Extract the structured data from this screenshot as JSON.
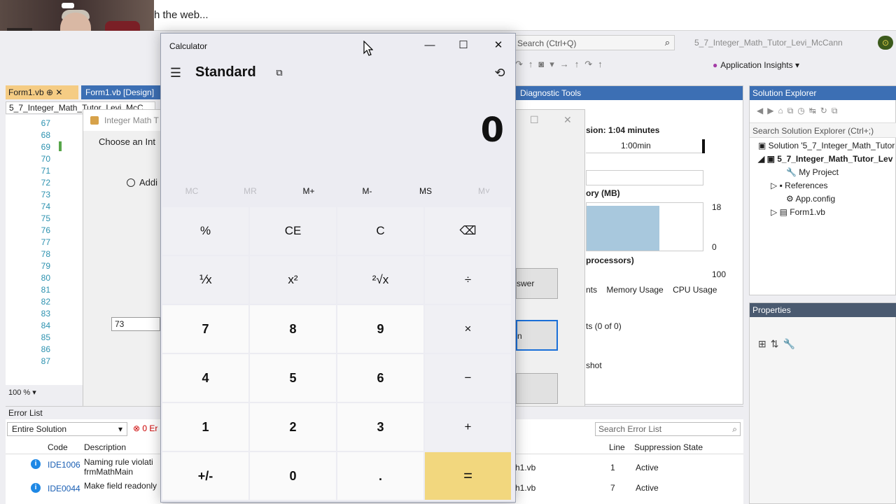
{
  "browser": {
    "address_text": "h the web..."
  },
  "vs": {
    "search_placeholder": "Search (Ctrl+Q)",
    "search_icon": "⌕",
    "project_title": "5_7_Integer_Math_Tutor_Levi_McCann",
    "app_insights": "Application Insights",
    "tabs": [
      {
        "label": "Form1.vb"
      },
      {
        "label": "Form1.vb [Design]"
      }
    ],
    "breadcrumb": "5_7_Integer_Math_Tutor_Levi_McC…",
    "line_numbers": [
      "67",
      "68",
      "69",
      "70",
      "71",
      "72",
      "73",
      "74",
      "75",
      "76",
      "77",
      "78",
      "79",
      "80",
      "81",
      "82",
      "83",
      "84",
      "85",
      "86",
      "87"
    ],
    "zoom": "100 %",
    "form_designer": {
      "title": "Integer Math T",
      "prompt": "Choose an Int",
      "radio_label": "Addi",
      "textbox_value": "73",
      "button_answer": "swer",
      "button_selected": "n"
    },
    "error_list": {
      "title": "Error List",
      "scope": "Entire Solution",
      "errors_badge": "0 Er",
      "col_code": "Code",
      "col_description": "Description",
      "col_line": "Line",
      "col_suppression": "Suppression State",
      "search_placeholder": "Search Error List",
      "rows": [
        {
          "code": "IDE1006",
          "description": "Naming rule violati frmMathMain",
          "file": "h1.vb",
          "line": "1",
          "state": "Active"
        },
        {
          "code": "IDE0044",
          "description": "Make field readonly",
          "file": "h1.vb",
          "line": "7",
          "state": "Active"
        }
      ]
    },
    "diagnostic": {
      "title": "Diagnostic Tools",
      "session": "sion: 1:04 minutes",
      "timeline_label": "1:00min",
      "memory_label": "ory (MB)",
      "mem_max": "18",
      "mem_min": "0",
      "processors_label": "processors)",
      "cpu_max": "100",
      "subtabs": [
        "nts",
        "Memory Usage",
        "CPU Usage"
      ],
      "events": "ts (0 of 0)",
      "snapshot": "shot"
    },
    "solution_explorer": {
      "title": "Solution Explorer",
      "search_placeholder": "Search Solution Explorer (Ctrl+;)",
      "solution": "Solution '5_7_Integer_Math_Tutor",
      "project": "5_7_Integer_Math_Tutor_Lev",
      "items": [
        "My Project",
        "References",
        "App.config",
        "Form1.vb"
      ]
    },
    "properties": {
      "title": "Properties"
    }
  },
  "calculator": {
    "window_title": "Calculator",
    "mode": "Standard",
    "display_value": "0",
    "memory_buttons": [
      {
        "label": "MC",
        "enabled": false
      },
      {
        "label": "MR",
        "enabled": false
      },
      {
        "label": "M+",
        "enabled": true
      },
      {
        "label": "M-",
        "enabled": true
      },
      {
        "label": "MS",
        "enabled": true
      },
      {
        "label": "M˅",
        "enabled": false
      }
    ],
    "keys": [
      [
        "%",
        "CE",
        "C",
        "⌫"
      ],
      [
        "⅟x",
        "x²",
        "²√x",
        "÷"
      ],
      [
        "7",
        "8",
        "9",
        "×"
      ],
      [
        "4",
        "5",
        "6",
        "−"
      ],
      [
        "1",
        "2",
        "3",
        "+"
      ],
      [
        "+/-",
        "0",
        ".",
        "="
      ]
    ],
    "accent_color": "#f2d77e"
  }
}
